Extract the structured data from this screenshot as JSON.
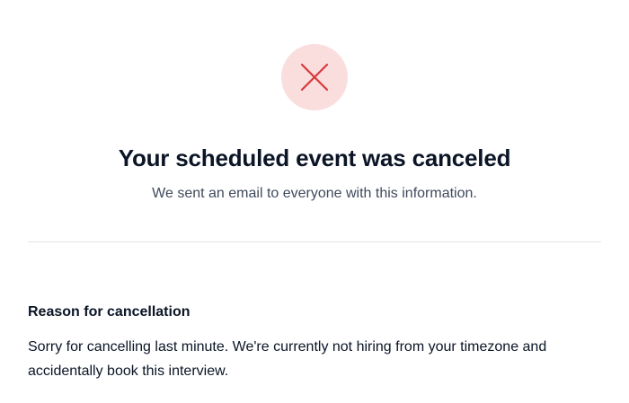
{
  "confirmation": {
    "status_icon": "close-x-icon",
    "icon_color": "#d9383a",
    "icon_bg_color": "#fadede",
    "title": "Your scheduled event was canceled",
    "subtitle": "We sent an email to everyone with this information."
  },
  "reason": {
    "heading": "Reason for cancellation",
    "text": "Sorry for cancelling last minute. We're currently not hiring from your timezone and accidentally book this interview."
  }
}
